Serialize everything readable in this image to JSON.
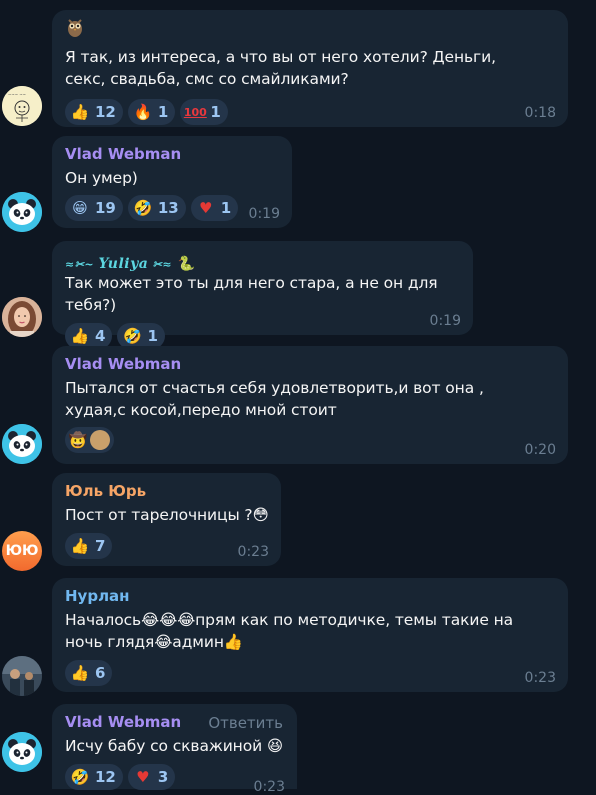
{
  "messages": [
    {
      "sender": "",
      "sticker": "owl-sticker",
      "text": "Я так, из интереса, а что вы от него хотели? Деньги, секс, свадьба, смс со смайликами?",
      "reactions": [
        {
          "emoji": "thumbs-up",
          "count": "12"
        },
        {
          "emoji": "fire",
          "count": "1"
        },
        {
          "emoji": "hundred",
          "count": "1"
        }
      ],
      "time": "0:18"
    },
    {
      "sender": "Vlad Webman",
      "text": "Он умер)",
      "reactions": [
        {
          "emoji": "grinning",
          "count": "19"
        },
        {
          "emoji": "rofl",
          "count": "13"
        },
        {
          "emoji": "heart",
          "count": "1"
        }
      ],
      "time": "0:19"
    },
    {
      "sender": "Yuliya",
      "sender_style": "decorative-nickname",
      "text": "Так может это ты для него стара, а не он для тебя?)",
      "reactions": [
        {
          "emoji": "thumbs-up",
          "count": "4"
        },
        {
          "emoji": "rofl",
          "count": "1"
        }
      ],
      "time": "0:19"
    },
    {
      "sender": "Vlad Webman",
      "text": "Пытался от счастья себя удовлетворить,и вот она , худая,с косой,передо мной стоит",
      "reactions": [
        {
          "emoji": "cowboy-face",
          "count": ""
        }
      ],
      "time": "0:20"
    },
    {
      "sender": "Юль Юрь",
      "text": "Пост от тарелочницы ?😳",
      "reactions": [
        {
          "emoji": "thumbs-up",
          "count": "7"
        }
      ],
      "time": "0:23"
    },
    {
      "sender": "Нурлан",
      "text": "Началось😂😂😂прям как по методичке, темы такие на ночь глядя😂админ👍",
      "reactions": [
        {
          "emoji": "thumbs-up",
          "count": "6"
        }
      ],
      "time": "0:23"
    },
    {
      "sender": "Vlad Webman",
      "reply_label": "Ответить",
      "text": "Исчу бабу со скважиной 😆",
      "reactions": [
        {
          "emoji": "rofl",
          "count": "12"
        },
        {
          "emoji": "heart",
          "count": "3"
        }
      ],
      "time": "0:23"
    }
  ],
  "avatars": {
    "yuyu_text": "ЮЮ"
  },
  "colors": {
    "background": "#0e1621",
    "bubble": "#182533",
    "reaction_bg": "#24354a",
    "reaction_text": "#9dc6f2",
    "time": "#6b7e91",
    "name_vlad": "#a68ef2",
    "name_yul": "#f6a566",
    "name_nurlan": "#71b8f0",
    "name_yuliya": "#5cd6e0"
  }
}
